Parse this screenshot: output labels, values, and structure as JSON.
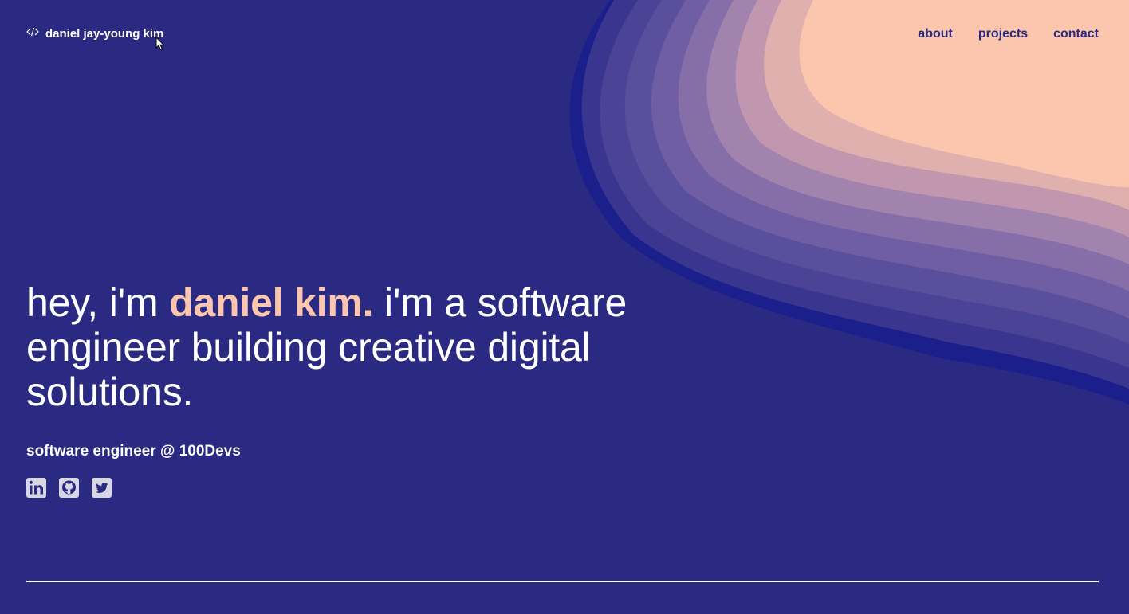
{
  "brand": {
    "icon": "code-icon",
    "name": "daniel jay-young kim"
  },
  "nav": {
    "about": "about",
    "projects": "projects",
    "contact": "contact"
  },
  "hero": {
    "intro": "hey, i'm ",
    "name": "daniel kim.",
    "rest": " i'm a software engineer building creative digital solutions."
  },
  "subtitle": "software engineer @ 100Devs",
  "socials": [
    {
      "icon": "linkedin-icon"
    },
    {
      "icon": "github-icon"
    },
    {
      "icon": "twitter-icon"
    }
  ],
  "colors": {
    "background": "#2b2a82",
    "accent": "#fbc6ad",
    "icon": "#d8d8e4"
  }
}
